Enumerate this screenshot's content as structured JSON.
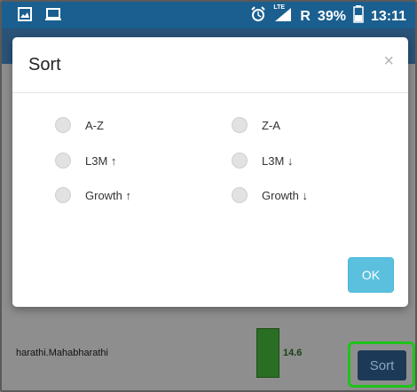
{
  "status_bar": {
    "battery": "39%",
    "time": "13:11",
    "network": "LTE",
    "roaming": "R",
    "icons": [
      "image-icon",
      "laptop-icon",
      "alarm-icon",
      "signal-icon",
      "battery-icon"
    ]
  },
  "background": {
    "rows": [
      {
        "label": "",
        "value": ""
      },
      {
        "label": "harathi.Mahabharathi",
        "value": "14.6"
      }
    ],
    "sort_button_label": "Sort"
  },
  "dialog": {
    "title": "Sort",
    "close_symbol": "×",
    "options": [
      {
        "label": "A-Z"
      },
      {
        "label": "Z-A"
      },
      {
        "label": "L3M ↑"
      },
      {
        "label": "L3M ↓"
      },
      {
        "label": "Growth ↑"
      },
      {
        "label": "Growth ↓"
      }
    ],
    "ok_label": "OK"
  }
}
